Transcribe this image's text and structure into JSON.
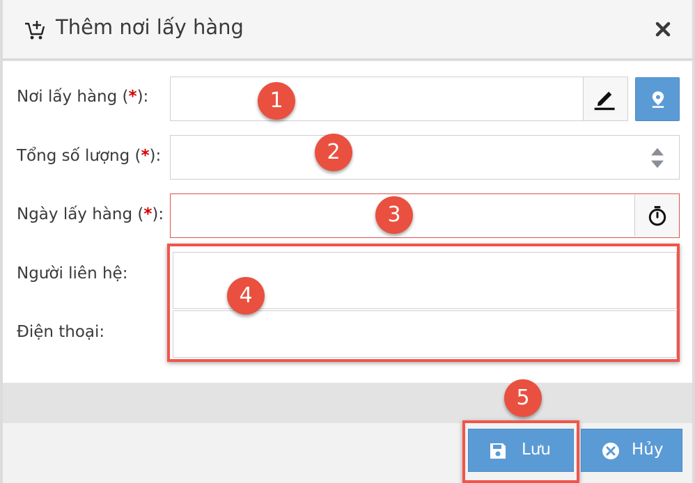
{
  "dialog": {
    "title": "Thêm nơi lấy hàng",
    "close_icon": "close-icon",
    "cart_icon": "cart-plus-icon"
  },
  "form": {
    "pickup_place": {
      "label": "Nơi lấy hàng (",
      "required_mark": "*",
      "label_end": "):",
      "value": ""
    },
    "total_quantity": {
      "label": "Tổng số lượng (",
      "required_mark": "*",
      "label_end": "):",
      "value": ""
    },
    "pickup_date": {
      "label": "Ngày lấy hàng (",
      "required_mark": "*",
      "label_end": "):",
      "value": ""
    },
    "contact_person": {
      "label": "Người liên hệ:",
      "value": ""
    },
    "phone": {
      "label": "Điện thoại:",
      "value": ""
    }
  },
  "buttons": {
    "save_label": "Lưu",
    "cancel_label": "Hủy"
  },
  "badges": [
    "1",
    "2",
    "3",
    "4",
    "5"
  ],
  "colors": {
    "accent": "#5b9bd5",
    "badge": "#e9503f",
    "highlight": "#f1554a",
    "required": "#d40000"
  }
}
